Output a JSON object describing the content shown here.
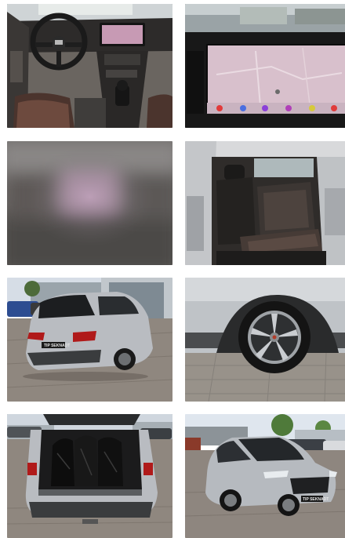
{
  "gallery": {
    "photos": [
      {
        "subject": "interior-dashboard"
      },
      {
        "subject": "infotainment-screen"
      },
      {
        "subject": "blurred-photo"
      },
      {
        "subject": "rear-seats"
      },
      {
        "subject": "rear-three-quarter-exterior"
      },
      {
        "subject": "wheel-closeup"
      },
      {
        "subject": "open-trunk"
      },
      {
        "subject": "front-three-quarter-exterior"
      }
    ],
    "dealer_plate_text": "TIP SEKNADT",
    "colors": {
      "car_silver": "#b9bcc1",
      "seat_leather": "#4a3a34",
      "screen_pink": "#d9b8c8",
      "sky": "#d6dde6",
      "pavement": "#8f877f",
      "taillight": "#b01a1a"
    }
  }
}
